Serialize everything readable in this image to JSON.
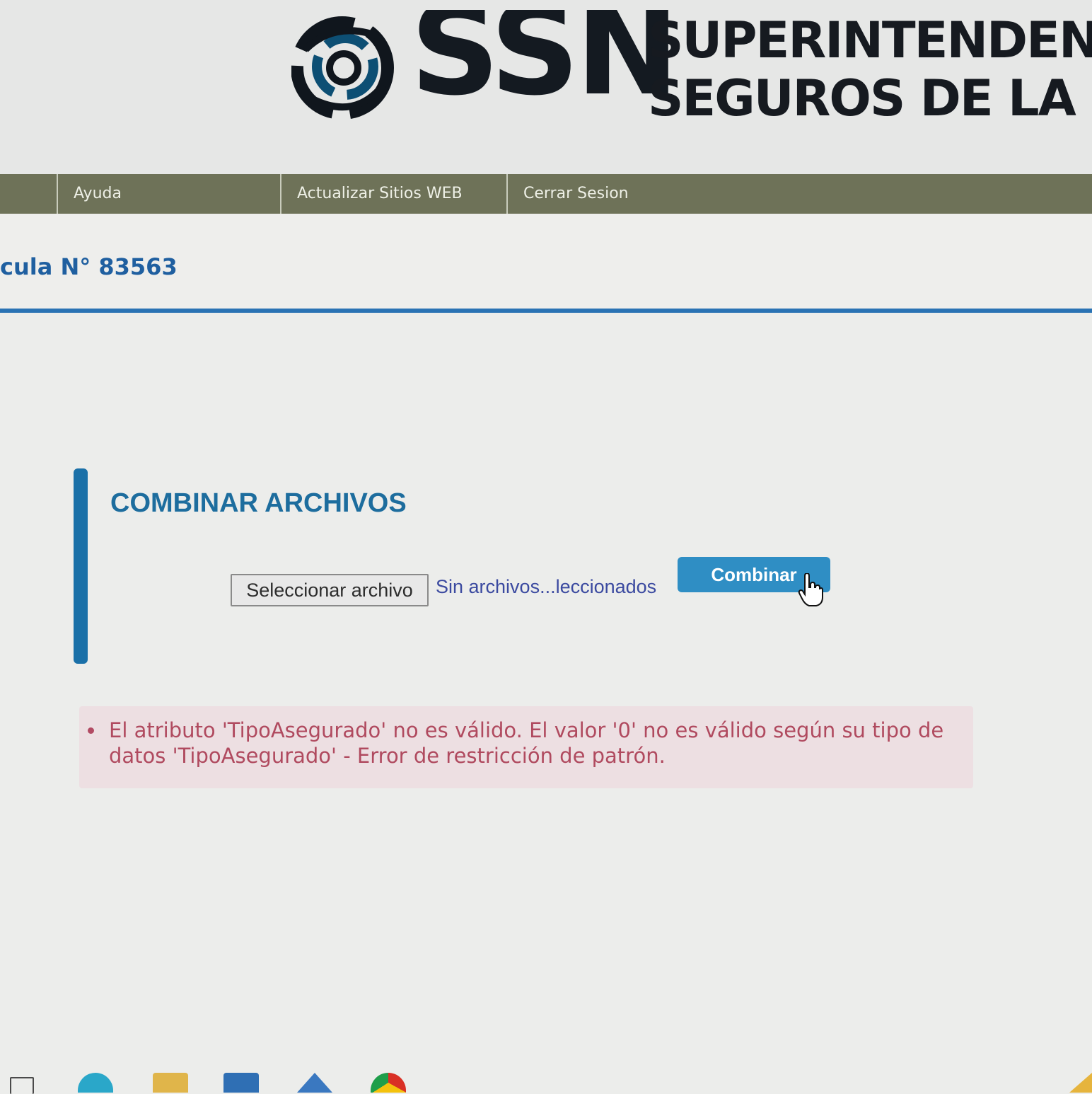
{
  "header": {
    "logo_mark": "SSN",
    "logo_line1": "SUPERINTENDENCI",
    "logo_line2": "SEGUROS DE LA NA"
  },
  "nav": {
    "items": [
      {
        "label": ""
      },
      {
        "label": "Ayuda"
      },
      {
        "label": "Actualizar Sitios WEB"
      },
      {
        "label": "Cerrar Sesion"
      }
    ]
  },
  "subheader": {
    "matricula": "cula N° 83563"
  },
  "main": {
    "title": "COMBINAR ARCHIVOS",
    "file_button_label": "Seleccionar archivo",
    "file_status": "Sin archivos...leccionados",
    "combine_button_label": "Combinar"
  },
  "error": {
    "message": "El atributo 'TipoAsegurado' no es válido. El valor '0' no es válido según su tipo de datos 'TipoAsegurado' - Error de restricción de patrón."
  },
  "icons": {
    "logo": "ssn-swirl-icon",
    "cursor": "hand-pointer-icon",
    "taskbar": [
      "start-icon",
      "edge-icon",
      "file-explorer-icon",
      "store-icon",
      "mail-icon",
      "chrome-icon"
    ]
  },
  "colors": {
    "nav_bg": "#6e7258",
    "accent_blue": "#2a73b4",
    "button_blue": "#2f8ec4",
    "error_text": "#b04a5f",
    "error_bg": "#eddfe2"
  }
}
